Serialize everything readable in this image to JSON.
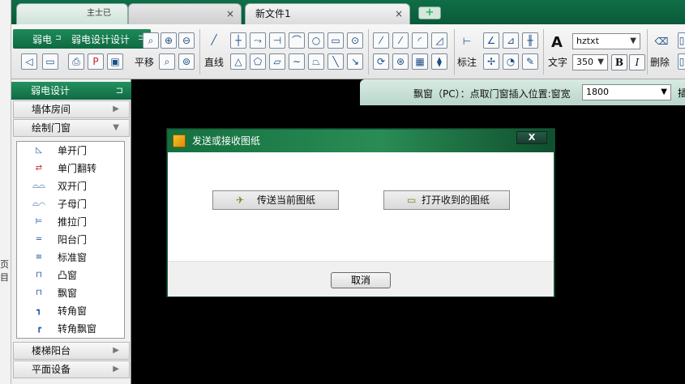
{
  "tabs": [
    {
      "label": "主士已"
    },
    {
      "label": ""
    },
    {
      "label": "新文件1"
    }
  ],
  "tab_add": "+",
  "tab_close": "×",
  "left_edge": {
    "fragment": "页目"
  },
  "ribbon": {
    "pane_title": "弱电",
    "pane_pin": "⊐",
    "pane_name": "弱电设计设计",
    "pane_pin2": "⊐",
    "pan_label": "平移",
    "line_label": "直线",
    "dimension_label": "标注",
    "text_label": "文字",
    "text_glyph": "A",
    "font_combo": "hztxt",
    "size_combo": "350",
    "bold": "B",
    "italic": "I",
    "delete_label": "删除"
  },
  "sidebar": {
    "title": "弱电设计",
    "pin": "⊐",
    "cats": [
      {
        "label": "墙体房间",
        "chev": "▶"
      },
      {
        "label": "绘制门窗",
        "chev": "▼"
      }
    ],
    "items": [
      {
        "label": "单开门",
        "icon": "door-single-icon"
      },
      {
        "label": "单门翻转",
        "icon": "door-flip-icon"
      },
      {
        "label": "双开门",
        "icon": "door-double-icon"
      },
      {
        "label": "子母门",
        "icon": "door-mother-child-icon"
      },
      {
        "label": "推拉门",
        "icon": "door-sliding-icon"
      },
      {
        "label": "阳台门",
        "icon": "door-balcony-icon"
      },
      {
        "label": "标准窗",
        "icon": "window-standard-icon"
      },
      {
        "label": "凸窗",
        "icon": "window-bay-icon"
      },
      {
        "label": "飘窗",
        "icon": "window-floating-icon"
      },
      {
        "label": "转角窗",
        "icon": "window-corner-icon"
      },
      {
        "label": "转角飘窗",
        "icon": "window-corner-floating-icon"
      }
    ],
    "bottom_cats": [
      {
        "label": "楼梯阳台",
        "chev": "▶"
      },
      {
        "label": "平面设备",
        "chev": "▶"
      }
    ]
  },
  "command_bar": {
    "prompt": "飘窗（PC）：点取门窗插入位置:窗宽",
    "value": "1800",
    "extra": "插"
  },
  "dialog": {
    "title": "发送或接收图纸",
    "close": "X",
    "send_button": "传送当前图纸",
    "open_button": "打开收到的图纸",
    "cancel_button": "取消"
  },
  "colors": {
    "accent_green": "#0f6e46",
    "canvas_black": "#000000"
  }
}
